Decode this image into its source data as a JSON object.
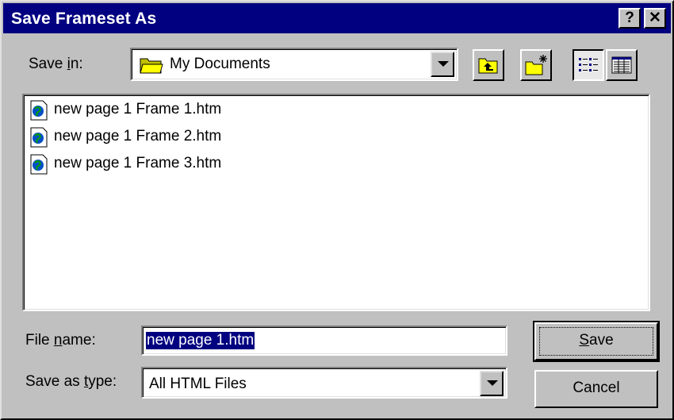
{
  "window": {
    "title": "Save Frameset As",
    "help_glyph": "?",
    "close_glyph": "✕"
  },
  "save_in": {
    "label_before": "Save ",
    "label_accel": "i",
    "label_after": "n:",
    "value": "My Documents"
  },
  "toolbar": {
    "up_icon": "up-one-level-icon",
    "new_folder_icon": "create-new-folder-icon",
    "list_icon": "list-view-icon",
    "details_icon": "details-view-icon",
    "active_view": "list"
  },
  "files": [
    {
      "name": "new page 1 Frame 1.htm",
      "icon": "html-document-icon"
    },
    {
      "name": "new page 1 Frame 2.htm",
      "icon": "html-document-icon"
    },
    {
      "name": "new page 1 Frame 3.htm",
      "icon": "html-document-icon"
    }
  ],
  "file_name": {
    "label_before": "File ",
    "label_accel": "n",
    "label_after": "ame:",
    "value": "new page 1.htm"
  },
  "save_as_type": {
    "label_before": "Save as ",
    "label_accel": "t",
    "label_after": "ype:",
    "value": "All HTML Files"
  },
  "buttons": {
    "save_accel": "S",
    "save_rest": "ave",
    "cancel": "Cancel"
  },
  "colors": {
    "titlebar": "#000080",
    "face": "#c0c0c0",
    "selection": "#000080",
    "folder": "#ffff00"
  }
}
